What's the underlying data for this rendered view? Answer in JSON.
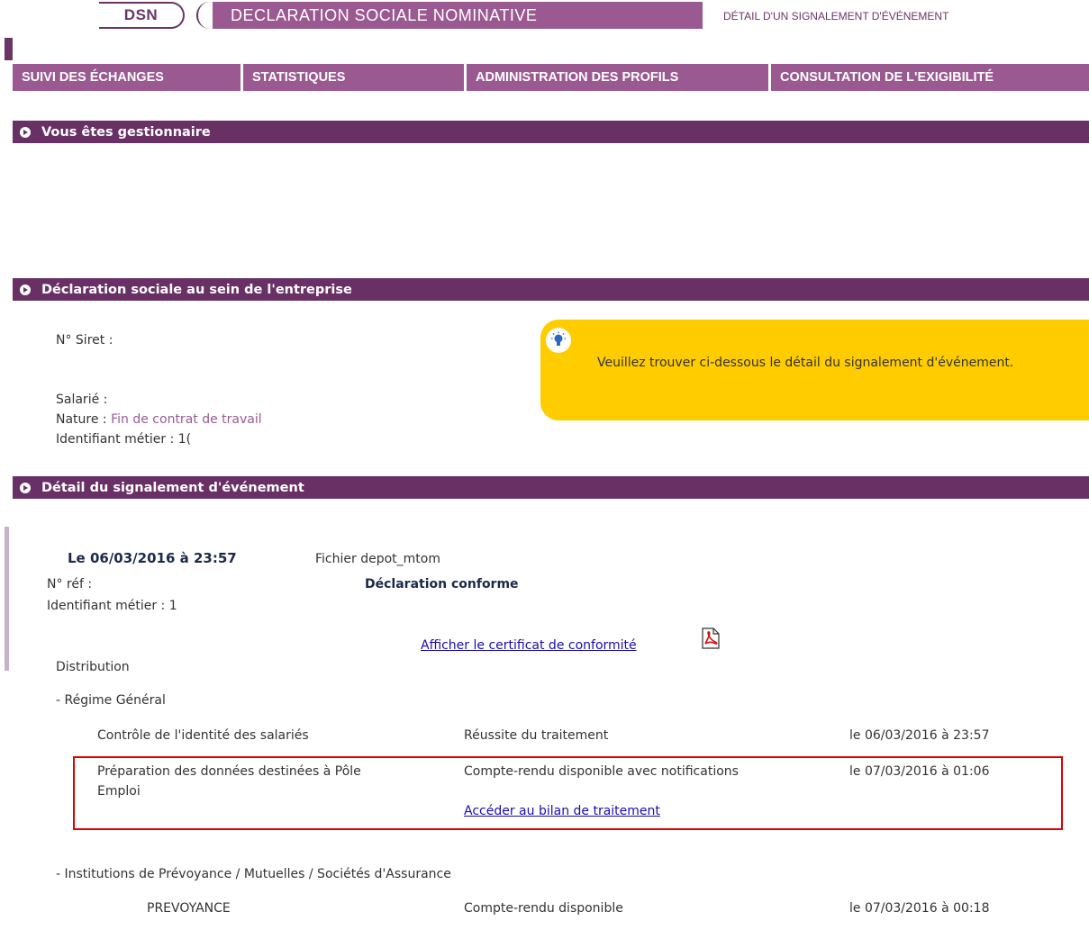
{
  "header": {
    "dsn": "DSN",
    "title": "DECLARATION SOCIALE NOMINATIVE",
    "subtitle": "DÉTAIL D'UN SIGNALEMENT D'ÉVÉNEMENT"
  },
  "nav": {
    "items": [
      {
        "label": "SUIVI DES ÉCHANGES"
      },
      {
        "label": "STATISTIQUES"
      },
      {
        "label": "ADMINISTRATION DES PROFILS"
      },
      {
        "label": "CONSULTATION DE L'EXIGIBILITÉ"
      }
    ]
  },
  "sections": {
    "gestionnaire": "Vous êtes gestionnaire",
    "entreprise": "Déclaration sociale au sein de l'entreprise",
    "detail": "Détail du signalement d'événement"
  },
  "entreprise": {
    "siret_label": "N° Siret :",
    "salarie_label": "Salarié :",
    "nature_label": "Nature :",
    "nature_value": "Fin de contrat de travail",
    "identifiant_label": "Identifiant métier :",
    "identifiant_value": "1("
  },
  "info": {
    "icon": "lightbulb-icon",
    "text": "Veuillez trouver ci-dessous le détail du signalement d'événement."
  },
  "detail": {
    "datetime": "Le 06/03/2016 à 23:57",
    "fichier": "Fichier depot_mtom",
    "ref_label": "N° réf :",
    "status": "Déclaration conforme",
    "identifiant": "Identifiant métier : 1",
    "certificat_link": "Afficher le certificat de conformité",
    "pdf_icon": "pdf-icon",
    "distribution": "Distribution",
    "regime_general": "- Régime Général",
    "rows": [
      {
        "name": "Contrôle de l'identité des salariés",
        "status": "Réussite du traitement",
        "date": "le 06/03/2016 à 23:57"
      },
      {
        "name_line1": "Préparation des données destinées à Pôle",
        "name_line2": "Emploi",
        "status": "Compte-rendu disponible avec notifications",
        "date": "le 07/03/2016 à 01:06",
        "link": "Accéder au bilan de traitement"
      }
    ],
    "institutions": "- Institutions de Prévoyance / Mutuelles / Sociétés d'Assurance",
    "prevoyance": {
      "name": "PREVOYANCE",
      "status": "Compte-rendu disponible",
      "date": "le 07/03/2016 à 00:18"
    }
  },
  "colors": {
    "brand_purple": "#683065",
    "nav_purple": "#9a5a91",
    "info_yellow": "#ffcc00",
    "highlight_red": "#e00000"
  }
}
